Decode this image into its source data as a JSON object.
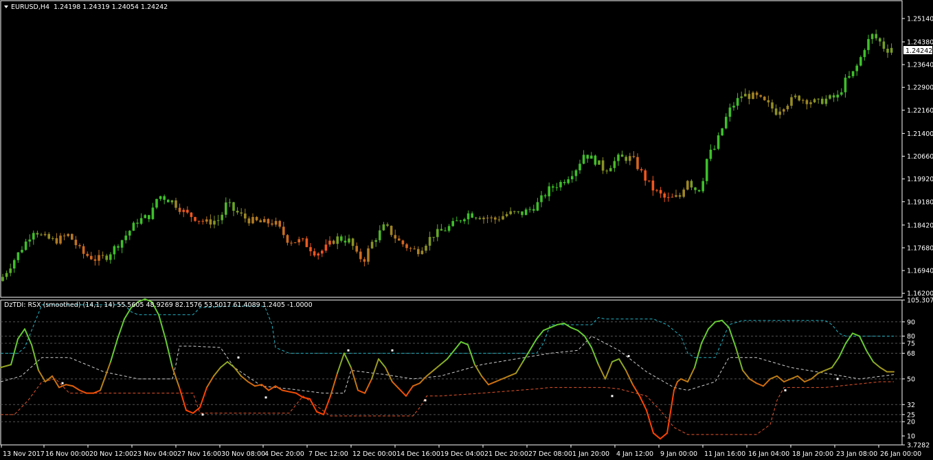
{
  "main_header": {
    "symbol": "EURUSD,H4",
    "ohlc": "1.24198 1.24319 1.24054 1.24242"
  },
  "indicator_header": {
    "text": "DzTDI:  RSX (smoothed) (14,1, 14) 55.5605 48.9269 82.1576 53.5017 61.4089 1.2405 -1.0000"
  },
  "current_price_label": "1.24242",
  "colors": {
    "background": "#000000",
    "frame": "#ffffff",
    "bull_candle": "#3dbf2a",
    "bear_candle": "#f2551e",
    "rsx_high": "#66cc33",
    "rsx_low": "#ff4400",
    "upper_band": "#1fb5c6",
    "lower_band": "#e8552a",
    "mid_band": "#d0d0d0",
    "level_lines": "#555555"
  },
  "chart_data": [
    {
      "type": "candlestick",
      "title": "EURUSD,H4",
      "ylim": [
        1.1607,
        1.2572
      ],
      "y_tick_labels": [
        "1.25140",
        "1.24380",
        "1.23640",
        "1.22900",
        "1.22160",
        "1.21400",
        "1.20660",
        "1.19920",
        "1.19180",
        "1.18420",
        "1.17680",
        "1.16940",
        "1.16200"
      ],
      "close_path": {
        "x_points": [
          0,
          40,
          50,
          60,
          80,
          100,
          120,
          140,
          155,
          180,
          200,
          220,
          230,
          250,
          270,
          290,
          300,
          320,
          330,
          340,
          360,
          380,
          400,
          420,
          440,
          460,
          470,
          490,
          510,
          520,
          530,
          540,
          560,
          580,
          600,
          610,
          630,
          650,
          670,
          680,
          700,
          720,
          740,
          760,
          780,
          800,
          820,
          840,
          850,
          870,
          880,
          900,
          920,
          940,
          950,
          970,
          990,
          1000,
          1010,
          1020,
          1030,
          1040,
          1050,
          1060,
          1070,
          1080,
          1100,
          1120,
          1130,
          1140,
          1160,
          1170,
          1190,
          1200,
          1220,
          1230,
          1240,
          1250,
          1260,
          1270,
          1280,
          1290,
          1300
        ],
        "closes": [
          1.166,
          1.1795,
          1.183,
          1.1805,
          1.179,
          1.181,
          1.175,
          1.173,
          1.174,
          1.18,
          1.1855,
          1.1875,
          1.194,
          1.192,
          1.188,
          1.186,
          1.185,
          1.186,
          1.1915,
          1.189,
          1.186,
          1.185,
          1.185,
          1.179,
          1.179,
          1.175,
          1.176,
          1.18,
          1.179,
          1.174,
          1.173,
          1.178,
          1.184,
          1.179,
          1.176,
          1.176,
          1.181,
          1.183,
          1.186,
          1.188,
          1.187,
          1.186,
          1.188,
          1.188,
          1.1905,
          1.196,
          1.1985,
          1.203,
          1.2075,
          1.2045,
          1.202,
          1.206,
          1.206,
          1.199,
          1.196,
          1.1925,
          1.1935,
          1.1995,
          1.196,
          1.196,
          1.207,
          1.209,
          1.215,
          1.221,
          1.224,
          1.2265,
          1.226,
          1.223,
          1.221,
          1.223,
          1.226,
          1.225,
          1.224,
          1.225,
          1.226,
          1.231,
          1.233,
          1.237,
          1.243,
          1.246,
          1.244,
          1.241,
          1.2424
        ]
      },
      "current_price": 1.24242
    },
    {
      "type": "line",
      "title": "DzTDI:  RSX (smoothed) (14,1, 14)",
      "ylim": [
        3.7282,
        105.3072
      ],
      "y_tick_labels": [
        "105.3072",
        "90",
        "80",
        "75",
        "68",
        "50",
        "32",
        "25",
        "20",
        "3.7282",
        "10"
      ],
      "levels": [
        90,
        80,
        75,
        68,
        50,
        32,
        25,
        20
      ],
      "series": [
        {
          "role": "rsx",
          "x": [
            0,
            15,
            25,
            35,
            45,
            55,
            65,
            75,
            85,
            95,
            105,
            115,
            125,
            135,
            145,
            160,
            170,
            180,
            190,
            200,
            210,
            220,
            230,
            240,
            250,
            260,
            270,
            280,
            290,
            300,
            310,
            320,
            330,
            340,
            350,
            360,
            370,
            380,
            390,
            400,
            410,
            420,
            430,
            440,
            450,
            460,
            470,
            480,
            490,
            500,
            510,
            520,
            530,
            540,
            550,
            560,
            570,
            580,
            590,
            600,
            610,
            620,
            630,
            640,
            650,
            660,
            670,
            680,
            690,
            700,
            710,
            720,
            730,
            740,
            750,
            760,
            770,
            780,
            790,
            800,
            810,
            820,
            830,
            840,
            850,
            860,
            870,
            880,
            890,
            900,
            910,
            920,
            930,
            940,
            950,
            960,
            970,
            980,
            985,
            990,
            1000,
            1010,
            1020,
            1030,
            1040,
            1050,
            1060,
            1070,
            1080,
            1090,
            1100,
            1110,
            1120,
            1130,
            1140,
            1150,
            1160,
            1170,
            1180,
            1190,
            1200,
            1210,
            1220,
            1230,
            1240,
            1250,
            1260,
            1270,
            1280,
            1290,
            1300
          ],
          "values": [
            58,
            60,
            78,
            85,
            74,
            56,
            48,
            52,
            44,
            46,
            45,
            42,
            40,
            40,
            42,
            62,
            78,
            92,
            100,
            104,
            106,
            104,
            95,
            78,
            58,
            44,
            28,
            26,
            30,
            44,
            52,
            58,
            62,
            58,
            52,
            48,
            45,
            46,
            42,
            45,
            42,
            41,
            40,
            37,
            36,
            27,
            25,
            38,
            54,
            68,
            58,
            42,
            40,
            50,
            64,
            58,
            48,
            43,
            38,
            45,
            47,
            52,
            56,
            60,
            64,
            70,
            76,
            74,
            60,
            52,
            46,
            48,
            50,
            52,
            54,
            62,
            70,
            78,
            84,
            86,
            88,
            89,
            86,
            84,
            80,
            72,
            60,
            50,
            62,
            64,
            56,
            46,
            38,
            28,
            12,
            8,
            12,
            42,
            48,
            50,
            48,
            58,
            75,
            85,
            90,
            91,
            86,
            72,
            56,
            50,
            47,
            45,
            50,
            52,
            48,
            50,
            52,
            48,
            50,
            54,
            56,
            58,
            65,
            75,
            82,
            80,
            70,
            62,
            58,
            55,
            55
          ]
        },
        {
          "role": "upper_band",
          "x": [
            0,
            25,
            35,
            60,
            180,
            190,
            200,
            280,
            290,
            340,
            380,
            385,
            395,
            400,
            420,
            500,
            600,
            700,
            780,
            790,
            800,
            860,
            870,
            880,
            950,
            960,
            970,
            990,
            1000,
            1010,
            1040,
            1060,
            1080,
            1200,
            1210,
            1220,
            1230,
            1300
          ],
          "values": [
            68,
            68,
            72,
            102,
            102,
            97,
            95,
            95,
            100,
            101,
            101,
            100,
            88,
            72,
            68,
            68,
            68,
            68,
            68,
            75,
            88,
            88,
            93,
            92,
            92,
            90,
            88,
            80,
            68,
            65,
            65,
            88,
            91,
            91,
            88,
            82,
            80,
            80
          ]
        },
        {
          "role": "mid_band",
          "x": [
            0,
            30,
            60,
            100,
            150,
            200,
            250,
            255,
            260,
            280,
            320,
            340,
            380,
            420,
            470,
            500,
            510,
            560,
            600,
            640,
            700,
            750,
            800,
            840,
            860,
            900,
            940,
            980,
            1000,
            1040,
            1060,
            1100,
            1150,
            1200,
            1250,
            1300
          ],
          "values": [
            48,
            52,
            65,
            65,
            55,
            50,
            50,
            60,
            73,
            73,
            72,
            58,
            45,
            43,
            40,
            40,
            56,
            53,
            50,
            52,
            60,
            64,
            68,
            70,
            80,
            70,
            55,
            44,
            42,
            48,
            65,
            65,
            58,
            54,
            50,
            53
          ]
        },
        {
          "role": "lower_band",
          "x": [
            0,
            20,
            40,
            60,
            80,
            100,
            120,
            125,
            140,
            200,
            280,
            285,
            290,
            300,
            350,
            420,
            440,
            480,
            600,
            610,
            620,
            640,
            700,
            780,
            800,
            880,
            900,
            940,
            960,
            980,
            1000,
            1100,
            1120,
            1130,
            1140,
            1200,
            1280,
            1300
          ],
          "values": [
            25,
            25,
            35,
            48,
            50,
            40,
            40,
            40,
            40,
            40,
            40,
            33,
            26,
            26,
            26,
            26,
            38,
            24,
            24,
            30,
            38,
            38,
            40,
            43,
            44,
            44,
            43,
            38,
            28,
            16,
            11,
            11,
            18,
            35,
            44,
            44,
            48,
            48
          ]
        }
      ],
      "markers": [
        {
          "x": 90,
          "y": 47
        },
        {
          "x": 294,
          "y": 25
        },
        {
          "x": 346,
          "y": 65
        },
        {
          "x": 386,
          "y": 37
        },
        {
          "x": 506,
          "y": 70
        },
        {
          "x": 570,
          "y": 70
        },
        {
          "x": 618,
          "y": 35
        },
        {
          "x": 890,
          "y": 38
        },
        {
          "x": 914,
          "y": 66
        },
        {
          "x": 1142,
          "y": 42
        },
        {
          "x": 1218,
          "y": 50
        }
      ]
    }
  ],
  "x_tick_labels": [
    "13 Nov 2017",
    "16 Nov 00:00",
    "20 Nov 12:00",
    "23 Nov 04:00",
    "27 Nov 16:00",
    "30 Nov 08:00",
    "4 Dec 20:00",
    "7 Dec 12:00",
    "12 Dec 00:00",
    "14 Dec 16:00",
    "19 Dec 04:00",
    "21 Dec 20:00",
    "27 Dec 08:00",
    "1 Jan 20:00",
    "4 Jan 12:00",
    "9 Jan 00:00",
    "11 Jan 16:00",
    "16 Jan 04:00",
    "18 Jan 20:00",
    "23 Jan 08:00",
    "26 Jan 00:00"
  ]
}
